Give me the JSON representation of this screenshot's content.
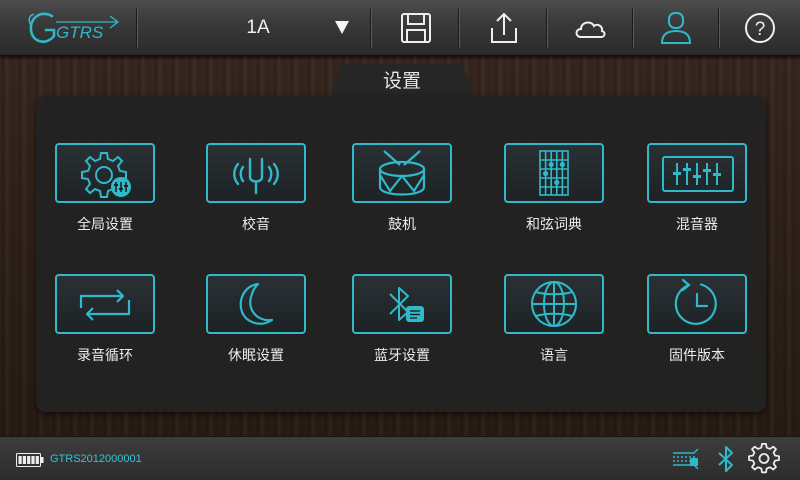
{
  "app": {
    "logo_text": "GTRS"
  },
  "toolbar": {
    "preset_value": "1A",
    "icons": [
      "dropdown-arrow-icon",
      "save-icon",
      "upload-icon",
      "cloud-icon",
      "user-icon",
      "help-icon"
    ],
    "help_label": "?"
  },
  "page": {
    "title": "设置"
  },
  "menu": {
    "items": [
      {
        "label": "全局设置",
        "icon": "global-settings-icon"
      },
      {
        "label": "校音",
        "icon": "tuning-fork-icon"
      },
      {
        "label": "鼓机",
        "icon": "drum-icon"
      },
      {
        "label": "和弦词典",
        "icon": "chord-chart-icon"
      },
      {
        "label": "混音器",
        "icon": "mixer-icon"
      },
      {
        "label": "录音循环",
        "icon": "loop-icon"
      },
      {
        "label": "休眠设置",
        "icon": "moon-icon"
      },
      {
        "label": "蓝牙设置",
        "icon": "bluetooth-settings-icon"
      },
      {
        "label": "语言",
        "icon": "globe-icon"
      },
      {
        "label": "固件版本",
        "icon": "firmware-clock-icon"
      }
    ]
  },
  "status": {
    "battery_level": 1.0,
    "serial": "GTRS2012000001",
    "icons": [
      "guitar-connect-icon",
      "bluetooth-icon",
      "gear-icon"
    ]
  },
  "colors": {
    "accent": "#2fb9c9",
    "text": "#ececec",
    "panel": "#222222"
  }
}
